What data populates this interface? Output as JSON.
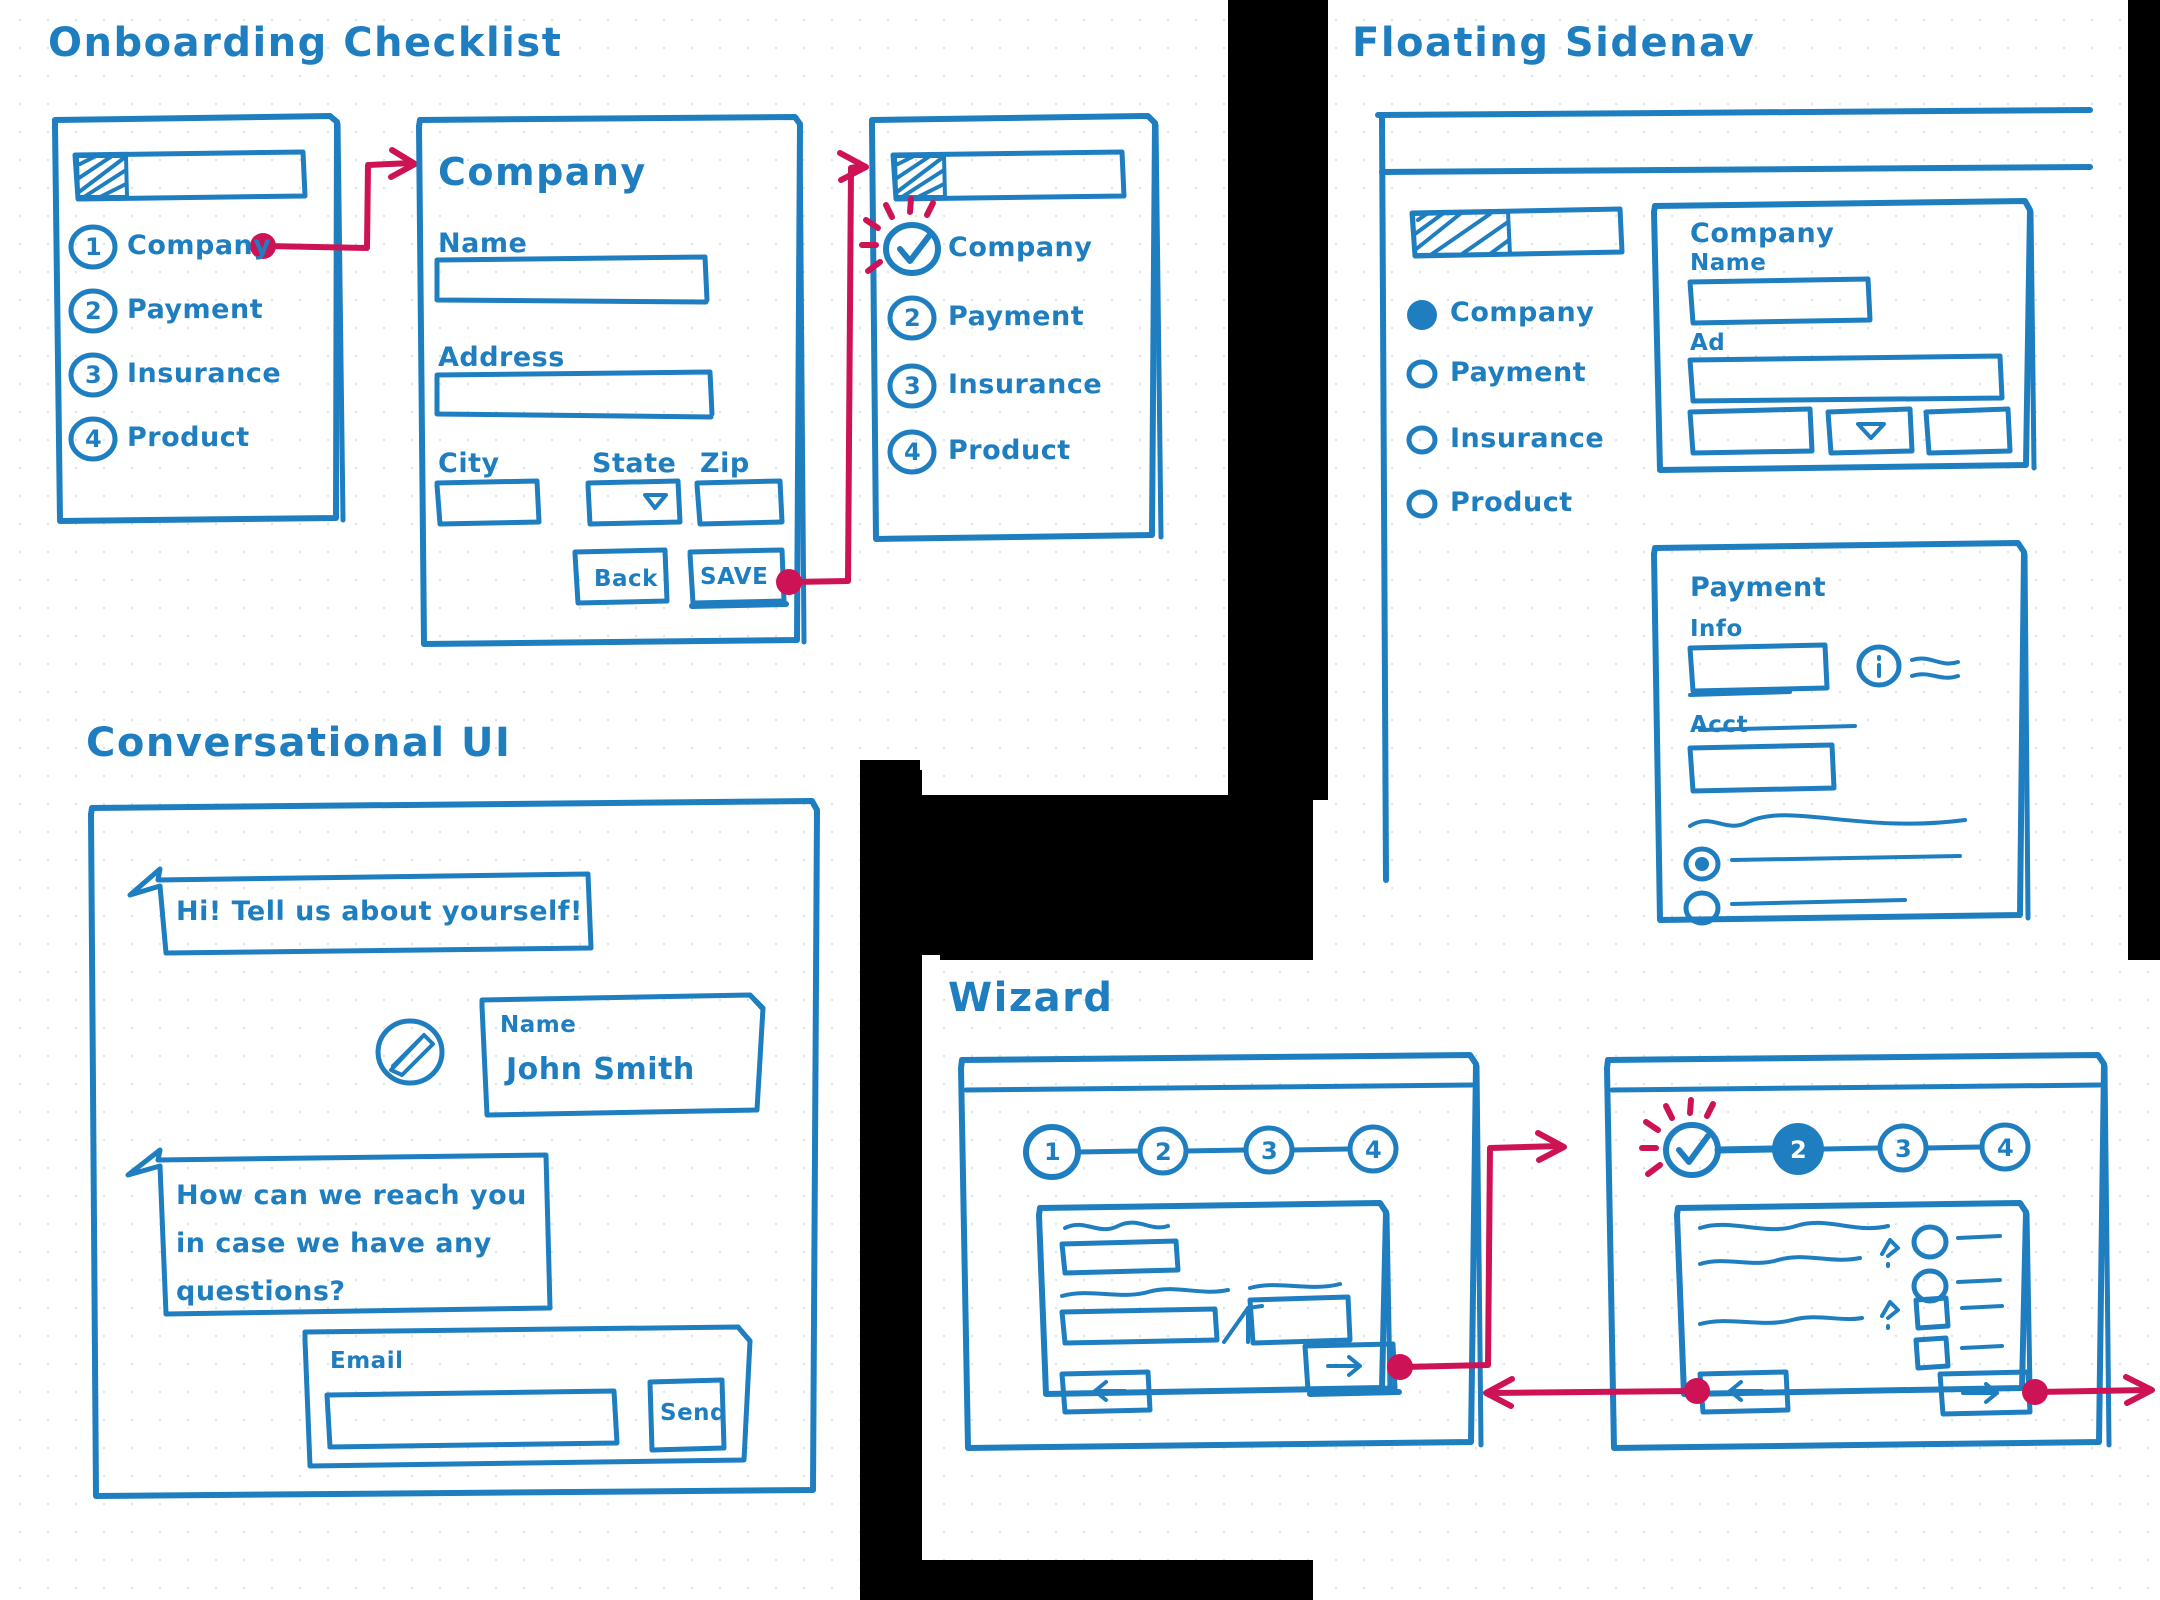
{
  "canvas": {
    "background": "#ffffff",
    "ink_color": "#1f7ec0",
    "accent_color": "#ce1256",
    "style": "hand-drawn wireframe sketch on dotted paper"
  },
  "sections": [
    {
      "id": "onboarding-checklist",
      "title": "Onboarding Checklist",
      "screens": [
        {
          "id": "checklist-initial",
          "progress_bar": {
            "present": true,
            "filled_fraction": 0.22
          },
          "steps": [
            {
              "number": "1",
              "label": "Company",
              "state": "active"
            },
            {
              "number": "2",
              "label": "Payment",
              "state": "pending"
            },
            {
              "number": "3",
              "label": "Insurance",
              "state": "pending"
            },
            {
              "number": "4",
              "label": "Product",
              "state": "pending"
            }
          ]
        },
        {
          "id": "company-form",
          "heading": "Company",
          "fields": [
            {
              "label": "Name",
              "type": "text",
              "value": ""
            },
            {
              "label": "Address",
              "type": "text",
              "value": ""
            },
            {
              "label": "City",
              "type": "text",
              "value": ""
            },
            {
              "label": "State",
              "type": "select",
              "value": ""
            },
            {
              "label": "Zip",
              "type": "text",
              "value": ""
            }
          ],
          "buttons": [
            {
              "label": "Back",
              "kind": "secondary"
            },
            {
              "label": "SAVE",
              "kind": "primary"
            }
          ]
        },
        {
          "id": "checklist-complete",
          "progress_bar": {
            "present": true,
            "filled_fraction": 0.22
          },
          "steps": [
            {
              "number": "check",
              "label": "Company",
              "state": "complete"
            },
            {
              "number": "2",
              "label": "Payment",
              "state": "pending"
            },
            {
              "number": "3",
              "label": "Insurance",
              "state": "pending"
            },
            {
              "number": "4",
              "label": "Product",
              "state": "pending"
            }
          ]
        }
      ]
    },
    {
      "id": "conversational-ui",
      "title": "Conversational UI",
      "messages": [
        {
          "from": "bot",
          "text": "Hi! Tell us about yourself!"
        },
        {
          "from": "user",
          "field_label": "Name",
          "value": "John Smith",
          "has_edit_icon": true
        },
        {
          "from": "bot",
          "text": "How can we reach you\nin case we have any\nquestions?"
        },
        {
          "from": "user",
          "field_label": "Email",
          "value": "",
          "button": "Send"
        }
      ]
    },
    {
      "id": "floating-sidenav",
      "title": "Floating Sidenav",
      "sidebar": {
        "progress_bar": {
          "present": true,
          "filled_fraction": 0.45
        },
        "items": [
          {
            "label": "Company",
            "state": "active"
          },
          {
            "label": "Payment",
            "state": "inactive"
          },
          {
            "label": "Insurance",
            "state": "inactive"
          },
          {
            "label": "Product",
            "state": "inactive"
          }
        ]
      },
      "cards": [
        {
          "heading": "Company",
          "fields": [
            {
              "label": "Name",
              "type": "text"
            },
            {
              "label": "Ad",
              "type": "text"
            },
            {
              "label": "",
              "type": "row-three"
            }
          ]
        },
        {
          "heading": "Payment",
          "fields": [
            {
              "label": "Info",
              "type": "text-with-info-icon"
            },
            {
              "label": "Acct",
              "type": "text"
            },
            {
              "label": "",
              "type": "scribble"
            },
            {
              "label": "",
              "type": "radio-selected"
            },
            {
              "label": "",
              "type": "radio-empty"
            }
          ]
        }
      ]
    },
    {
      "id": "wizard",
      "title": "Wizard",
      "screens": [
        {
          "id": "wizard-step-1",
          "stepper": [
            {
              "number": "1",
              "state": "active"
            },
            {
              "number": "2",
              "state": "pending"
            },
            {
              "number": "3",
              "state": "pending"
            },
            {
              "number": "4",
              "state": "pending"
            }
          ],
          "buttons": [
            {
              "label": "back-arrow",
              "icon": "arrow-left-icon"
            },
            {
              "label": "next-arrow",
              "icon": "arrow-right-icon",
              "kind": "primary"
            }
          ]
        },
        {
          "id": "wizard-step-2",
          "stepper": [
            {
              "number": "check",
              "state": "complete"
            },
            {
              "number": "2",
              "state": "active"
            },
            {
              "number": "3",
              "state": "pending"
            },
            {
              "number": "4",
              "state": "pending"
            }
          ],
          "buttons": [
            {
              "label": "back-arrow",
              "icon": "arrow-left-icon"
            },
            {
              "label": "next-arrow",
              "icon": "arrow-right-icon",
              "kind": "primary"
            }
          ]
        }
      ]
    }
  ],
  "flow_arrows": [
    {
      "from": "checklist-initial.step-company",
      "to": "company-form"
    },
    {
      "from": "company-form.save-button",
      "to": "checklist-complete"
    },
    {
      "from": "wizard-step-1.next-arrow",
      "to": "wizard-step-2"
    },
    {
      "from": "wizard-step-2.back-arrow",
      "to": "wizard-step-1"
    },
    {
      "from": "wizard-step-2.next-arrow",
      "to": "offscreen-right"
    }
  ]
}
